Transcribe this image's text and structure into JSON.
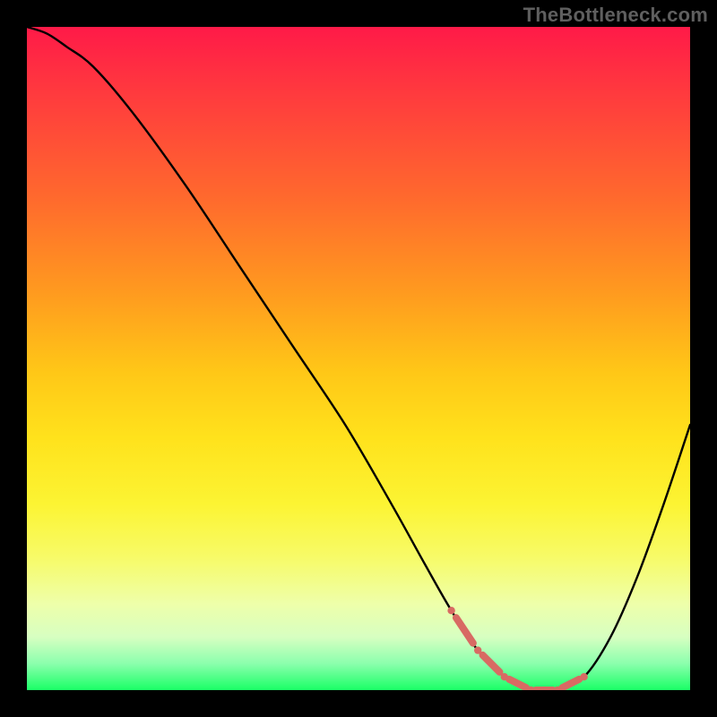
{
  "watermark": "TheBottleneck.com",
  "colors": {
    "frame_bg": "#000000",
    "curve_stroke": "#000000",
    "marker_stroke": "#d86a63",
    "gradient_top": "#ff1a48",
    "gradient_bottom": "#1aff66"
  },
  "chart_data": {
    "type": "line",
    "title": "",
    "xlabel": "",
    "ylabel": "",
    "grid": false,
    "xlim": [
      0,
      100
    ],
    "ylim": [
      0,
      100
    ],
    "x": [
      0,
      3,
      6,
      10,
      16,
      24,
      32,
      40,
      48,
      55,
      60,
      64,
      68,
      72,
      76,
      80,
      84,
      88,
      92,
      96,
      100
    ],
    "series": [
      {
        "name": "bottleneck-curve",
        "values": [
          100,
          99,
          97,
          94,
          87,
          76,
          64,
          52,
          40,
          28,
          19,
          12,
          6,
          2,
          0,
          0,
          2,
          8,
          17,
          28,
          40
        ]
      }
    ],
    "markers": {
      "name": "optimal-range",
      "x": [
        64,
        68,
        72,
        76,
        80,
        84
      ],
      "values": [
        12,
        6,
        2,
        0,
        0,
        2
      ],
      "note": "short red dashed markers along the curve near its minimum"
    }
  }
}
